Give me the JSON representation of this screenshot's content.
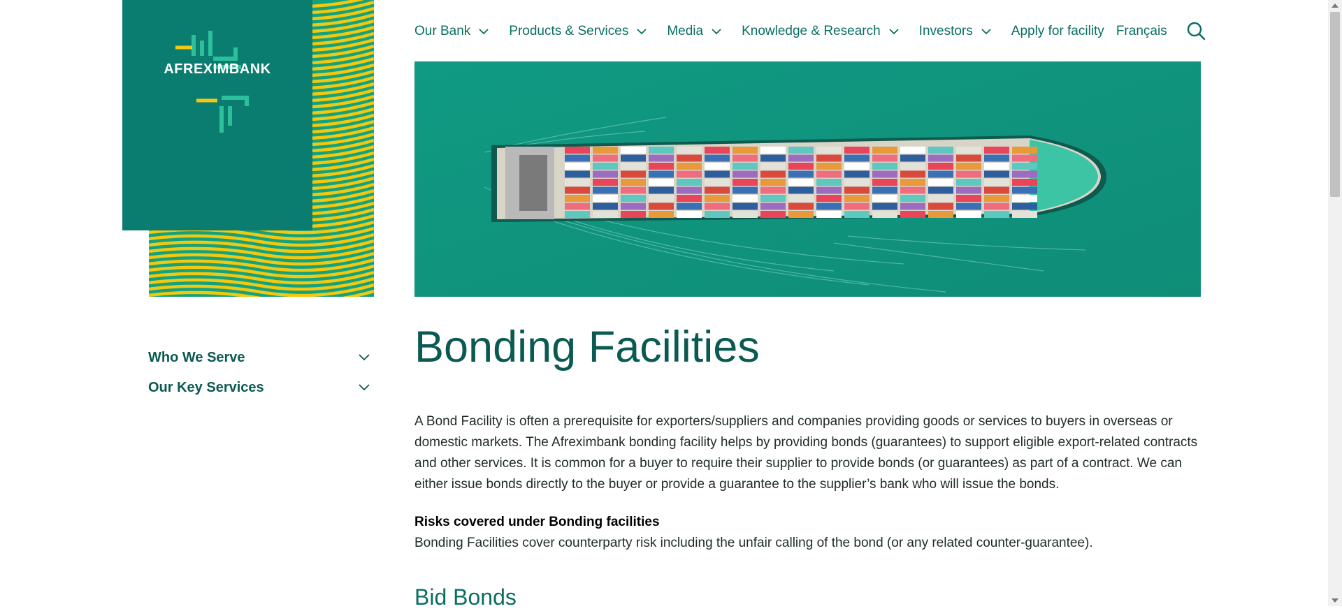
{
  "brand": {
    "name": "AFREXIMBANK",
    "primary_color": "#0b7d70",
    "accent_color": "#f2c811"
  },
  "nav": {
    "items": [
      {
        "label": "Our Bank",
        "has_dropdown": true
      },
      {
        "label": "Products & Services",
        "has_dropdown": true
      },
      {
        "label": "Media",
        "has_dropdown": true
      },
      {
        "label": "Knowledge & Research",
        "has_dropdown": true
      },
      {
        "label": "Investors",
        "has_dropdown": true
      },
      {
        "label": "Apply for facility",
        "has_dropdown": false
      },
      {
        "label": "Français",
        "has_dropdown": false
      }
    ],
    "search_icon": "search-icon"
  },
  "hero": {
    "image": "container-ship-aerial"
  },
  "sidebar": {
    "items": [
      {
        "label": "Who We Serve"
      },
      {
        "label": "Our Key Services"
      }
    ]
  },
  "main": {
    "title": "Bonding Facilities",
    "intro": "A Bond Facility is often a prerequisite for exporters/suppliers and companies providing goods or services to buyers in overseas or domestic markets. The Afreximbank bonding facility helps by providing bonds (guarantees) to support eligible export-related contracts and other services. It is common for a buyer to require their supplier to provide bonds (or guarantees) as part of a contract. We can either issue bonds directly to the buyer or provide a guarantee to the supplier’s bank who will issue the bonds.",
    "risks_heading": "Risks covered under Bonding facilities",
    "risks_text": "Bonding Facilities cover counterparty risk including the unfair calling of the bond (or any related counter-guarantee).",
    "sub_heading": "Bid Bonds"
  }
}
